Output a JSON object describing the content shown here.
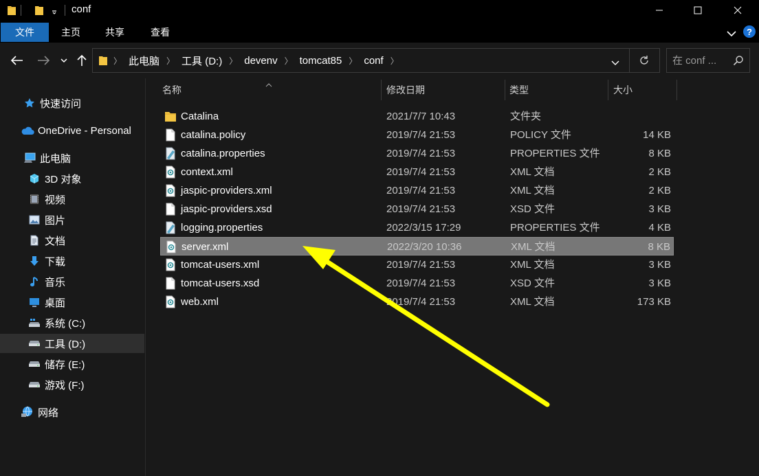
{
  "window": {
    "title": "conf",
    "controls": [
      "minimize-icon",
      "maximize-icon",
      "close-icon"
    ]
  },
  "ribbon": {
    "tabs": [
      {
        "label": "文件",
        "active": true
      },
      {
        "label": "主页",
        "active": false
      },
      {
        "label": "共享",
        "active": false
      },
      {
        "label": "查看",
        "active": false
      }
    ],
    "help": "?"
  },
  "address": {
    "crumbs": [
      "此电脑",
      "工具 (D:)",
      "devenv",
      "tomcat85",
      "conf"
    ],
    "search_placeholder": "在 conf ..."
  },
  "sidebar": {
    "items": [
      {
        "label": "快速访问",
        "icon": "star-icon"
      },
      {
        "label": "OneDrive - Personal",
        "icon": "cloud-icon"
      },
      {
        "label": "此电脑",
        "icon": "computer-icon"
      },
      {
        "label": "3D 对象",
        "icon": "cube-icon"
      },
      {
        "label": "视频",
        "icon": "video-icon"
      },
      {
        "label": "图片",
        "icon": "picture-icon"
      },
      {
        "label": "文档",
        "icon": "document-icon"
      },
      {
        "label": "下载",
        "icon": "download-icon"
      },
      {
        "label": "音乐",
        "icon": "music-icon"
      },
      {
        "label": "桌面",
        "icon": "desktop-icon"
      },
      {
        "label": "系统 (C:)",
        "icon": "windows-drive-icon"
      },
      {
        "label": "工具 (D:)",
        "icon": "drive-icon",
        "selected": true
      },
      {
        "label": "储存 (E:)",
        "icon": "drive-icon"
      },
      {
        "label": "游戏 (F:)",
        "icon": "drive-icon"
      },
      {
        "label": "网络",
        "icon": "network-icon"
      }
    ]
  },
  "columns": {
    "name": "名称",
    "date": "修改日期",
    "type": "类型",
    "size": "大小"
  },
  "files": [
    {
      "name": "Catalina",
      "date": "2021/7/7 10:43",
      "type": "文件夹",
      "size": "",
      "icon": "folder-icon"
    },
    {
      "name": "catalina.policy",
      "date": "2019/7/4 21:53",
      "type": "POLICY 文件",
      "size": "14 KB",
      "icon": "file-icon"
    },
    {
      "name": "catalina.properties",
      "date": "2019/7/4 21:53",
      "type": "PROPERTIES 文件",
      "size": "8 KB",
      "icon": "properties-file-icon"
    },
    {
      "name": "context.xml",
      "date": "2019/7/4 21:53",
      "type": "XML 文档",
      "size": "2 KB",
      "icon": "xml-file-icon"
    },
    {
      "name": "jaspic-providers.xml",
      "date": "2019/7/4 21:53",
      "type": "XML 文档",
      "size": "2 KB",
      "icon": "xml-file-icon"
    },
    {
      "name": "jaspic-providers.xsd",
      "date": "2019/7/4 21:53",
      "type": "XSD 文件",
      "size": "3 KB",
      "icon": "file-icon"
    },
    {
      "name": "logging.properties",
      "date": "2022/3/15 17:29",
      "type": "PROPERTIES 文件",
      "size": "4 KB",
      "icon": "properties-file-icon"
    },
    {
      "name": "server.xml",
      "date": "2022/3/20 10:36",
      "type": "XML 文档",
      "size": "8 KB",
      "icon": "xml-file-icon",
      "selected": true
    },
    {
      "name": "tomcat-users.xml",
      "date": "2019/7/4 21:53",
      "type": "XML 文档",
      "size": "3 KB",
      "icon": "xml-file-icon"
    },
    {
      "name": "tomcat-users.xsd",
      "date": "2019/7/4 21:53",
      "type": "XSD 文件",
      "size": "3 KB",
      "icon": "file-icon"
    },
    {
      "name": "web.xml",
      "date": "2019/7/4 21:53",
      "type": "XML 文档",
      "size": "173 KB",
      "icon": "xml-file-icon"
    }
  ],
  "colors": {
    "accent_tab": "#1a6bb8",
    "annotation_arrow": "#ffff00",
    "selection": "#777777",
    "folder": "#f4c542"
  }
}
